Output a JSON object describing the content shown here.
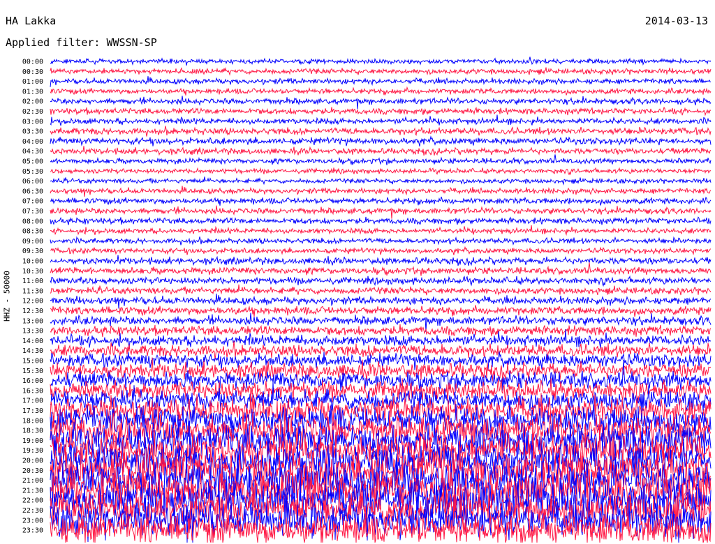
{
  "header": {
    "station": "HA Lakka",
    "date": "2014-03-13",
    "filter": "Applied filter: WWSSN-SP"
  },
  "ylabel": "HHZ - 50000",
  "colors": {
    "even_rows": "#0000ff",
    "odd_rows": "#ff1744",
    "background": "#ffffff"
  },
  "chart_data": {
    "type": "line",
    "title": "HA Lakka",
    "subtitle": "Applied filter: WWSSN-SP",
    "ylabel": "HHZ - 50000",
    "row_interval_minutes": 30,
    "row_labels": [
      "00:00",
      "00:30",
      "01:00",
      "01:30",
      "02:00",
      "02:30",
      "03:00",
      "03:30",
      "04:00",
      "04:30",
      "05:00",
      "05:30",
      "06:00",
      "06:30",
      "07:00",
      "07:30",
      "08:00",
      "08:30",
      "09:00",
      "09:30",
      "10:00",
      "10:30",
      "11:00",
      "11:30",
      "12:00",
      "12:30",
      "13:00",
      "13:30",
      "14:00",
      "14:30",
      "15:00",
      "15:30",
      "16:00",
      "16:30",
      "17:00",
      "17:30",
      "18:00",
      "18:30",
      "19:00",
      "19:30",
      "20:00",
      "20:30",
      "21:00",
      "21:30",
      "22:00",
      "22:30",
      "23:00",
      "23:30"
    ],
    "relative_amplitude": [
      0.7,
      0.8,
      0.8,
      0.8,
      0.9,
      0.9,
      0.9,
      1.0,
      1.0,
      0.9,
      0.8,
      0.7,
      0.7,
      0.8,
      0.9,
      0.9,
      0.9,
      0.8,
      0.8,
      0.8,
      1.0,
      1.0,
      1.0,
      1.0,
      1.1,
      1.2,
      1.3,
      1.4,
      1.6,
      1.8,
      2.0,
      2.3,
      2.5,
      2.6,
      3.0,
      3.5,
      4.2,
      4.5,
      4.8,
      5.0,
      5.2,
      5.5,
      5.6,
      5.8,
      5.6,
      5.5,
      5.0,
      4.5
    ],
    "grid": false
  }
}
